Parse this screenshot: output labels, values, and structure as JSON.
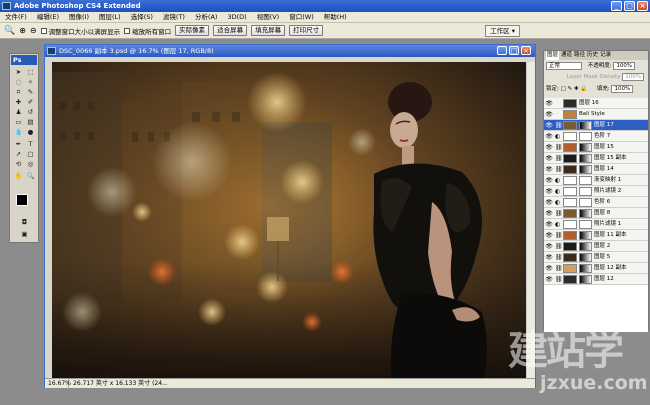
{
  "app": {
    "title": "Adobe Photoshop CS4 Extended",
    "window_buttons": [
      "_",
      "□",
      "×"
    ]
  },
  "menu": [
    "文件(F)",
    "编辑(E)",
    "图像(I)",
    "图层(L)",
    "选择(S)",
    "滤镜(T)",
    "分析(A)",
    "3D(D)",
    "视图(V)",
    "窗口(W)",
    "帮助(H)"
  ],
  "options_bar": {
    "check1": "调整窗口大小以满屏显示",
    "check2": "缩放所有窗口",
    "btn_actual": "实际像素",
    "btn_fit": "适合屏幕",
    "btn_fill": "填充屏幕",
    "btn_print": "打印尺寸",
    "workspace": "工作区 ▾"
  },
  "toolbox": {
    "logo": "Ps"
  },
  "document": {
    "title": "DSC_0066 副本 3.psd @ 16.7% (图层 17, RGB/8)",
    "zoom": "16.67%",
    "doc_info": "26.717 英寸 x 16.133 英寸 (24..."
  },
  "layers_panel": {
    "tabs": [
      "图层",
      "通道",
      "路径",
      "历史",
      "记录"
    ],
    "blend_mode": "正常",
    "opacity_label": "不透明度:",
    "opacity": "100%",
    "density_label": "Layer Mask Density",
    "density": "100%",
    "lock_label": "锁定:",
    "fill_label": "填充:",
    "fill": "100%",
    "layers": [
      {
        "name": "图层 16",
        "type": "plain",
        "active": false
      },
      {
        "name": "Bali Style",
        "type": "plain",
        "active": false
      },
      {
        "name": "图层 17",
        "type": "masked",
        "active": true
      },
      {
        "name": "色阶 7",
        "type": "adjust",
        "active": false
      },
      {
        "name": "图层 15",
        "type": "masked",
        "active": false
      },
      {
        "name": "图层 15 副本",
        "type": "masked",
        "active": false
      },
      {
        "name": "图层 14",
        "type": "masked",
        "active": false
      },
      {
        "name": "渐变映射 1",
        "type": "adjust",
        "active": false
      },
      {
        "name": "照片滤镜 2",
        "type": "adjust",
        "active": false
      },
      {
        "name": "色阶 6",
        "type": "adjust",
        "active": false
      },
      {
        "name": "图层 8",
        "type": "masked",
        "active": false
      },
      {
        "name": "照片滤镜 1",
        "type": "adjust",
        "active": false
      },
      {
        "name": "图层 11 副本",
        "type": "masked",
        "active": false
      },
      {
        "name": "图层 2",
        "type": "masked",
        "active": false
      },
      {
        "name": "图层 5",
        "type": "masked",
        "active": false
      },
      {
        "name": "图层 12 副本",
        "type": "masked",
        "active": false
      },
      {
        "name": "图层 12",
        "type": "masked",
        "active": false
      }
    ]
  },
  "watermark": {
    "text": "建站学",
    "url": "jzxue.com"
  },
  "colors": {
    "accent": "#2f5fc4",
    "titlebar": "#1d4fbf",
    "chrome": "#ece9d8"
  }
}
